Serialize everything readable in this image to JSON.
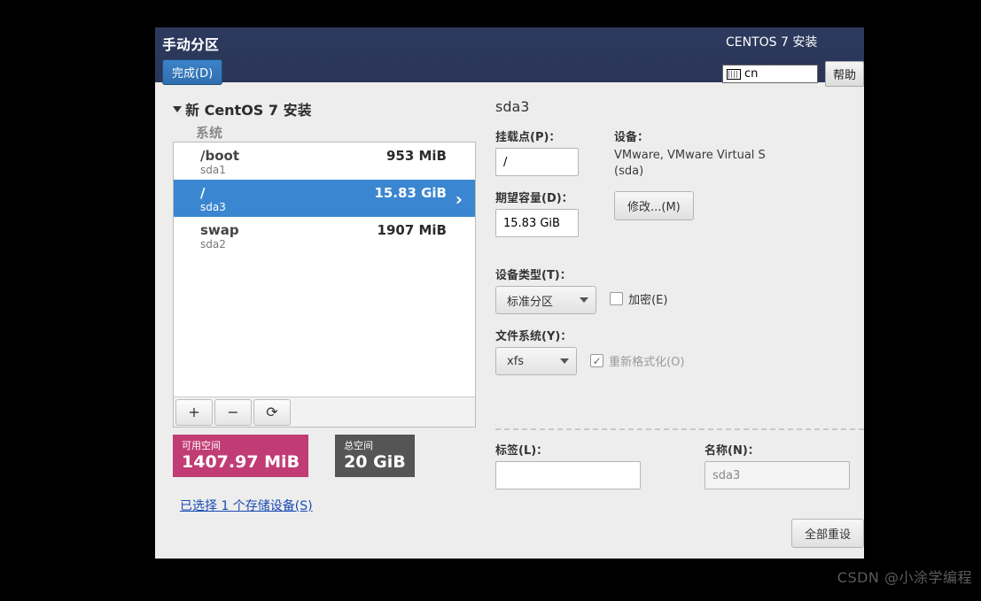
{
  "header": {
    "title": "手动分区",
    "done": "完成(D)",
    "subtitle": "CENTOS 7 安装",
    "lang": "cn",
    "help": "帮助"
  },
  "sidebar": {
    "expander": "新 CentOS 7 安装",
    "group": "系统",
    "partitions": [
      {
        "mount": "/boot",
        "size": "953 MiB",
        "dev": "sda1"
      },
      {
        "mount": "/",
        "size": "15.83 GiB",
        "dev": "sda3"
      },
      {
        "mount": "swap",
        "size": "1907 MiB",
        "dev": "sda2"
      }
    ],
    "toolbar": {
      "add": "+",
      "remove": "−",
      "reload": "⟳"
    },
    "space": {
      "avail_label": "可用空间",
      "avail_value": "1407.97 MiB",
      "total_label": "总空间",
      "total_value": "20 GiB"
    },
    "storage_link": "已选择 1 个存储设备(S)"
  },
  "details": {
    "title": "sda3",
    "mount_label": "挂载点(P)：",
    "mount_value": "/",
    "capacity_label": "期望容量(D)：",
    "capacity_value": "15.83 GiB",
    "device_label": "设备：",
    "device_info": "VMware, VMware Virtual S (sda)",
    "modify": "修改...(M)",
    "type_label": "设备类型(T)：",
    "type_value": "标准分区",
    "encrypt_label": "加密(E)",
    "fs_label": "文件系统(Y)：",
    "fs_value": "xfs",
    "reformat_label": "重新格式化(O)",
    "tag_label": "标签(L)：",
    "tag_value": "",
    "name_label": "名称(N)：",
    "name_value": "sda3"
  },
  "footer": {
    "reset_all": "全部重设"
  },
  "watermark": "CSDN @小涂学编程"
}
